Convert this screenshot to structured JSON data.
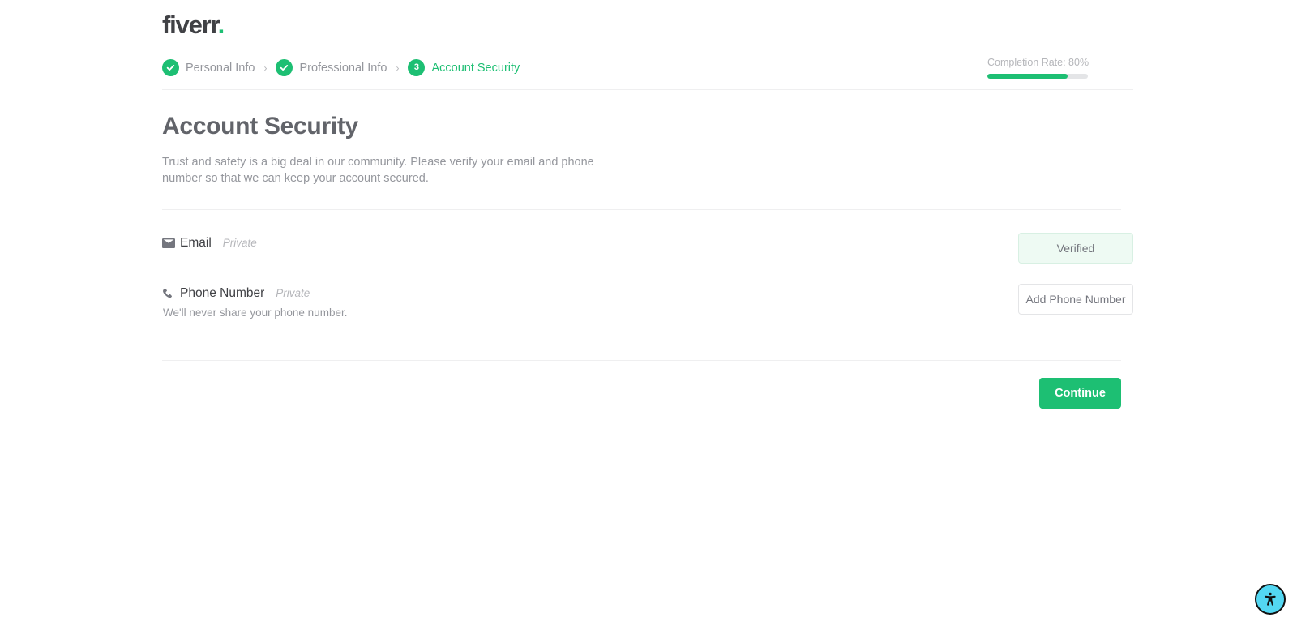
{
  "brand": {
    "name": "fiverr",
    "dot": ".",
    "accent_color": "#1dbf73"
  },
  "stepper": {
    "steps": [
      {
        "badge": "check",
        "label": "Personal Info",
        "state": "completed"
      },
      {
        "badge": "check",
        "label": "Professional Info",
        "state": "completed"
      },
      {
        "badge": "3",
        "label": "Account Security",
        "state": "current"
      }
    ],
    "separator": "›",
    "completion": {
      "label": "Completion Rate: 80%",
      "percent": 80
    }
  },
  "main": {
    "title": "Account Security",
    "description": "Trust and safety is a big deal in our community. Please verify your email and phone number so that we can keep your account secured.",
    "rows": [
      {
        "icon": "envelope-icon",
        "title": "Email",
        "privacy": "Private",
        "subtitle": "",
        "action_label": "Verified"
      },
      {
        "icon": "phone-icon",
        "title": "Phone Number",
        "privacy": "Private",
        "subtitle": "We'll never share your phone number.",
        "action_label": "Add Phone Number"
      }
    ],
    "continue_label": "Continue"
  },
  "accessibility_widget": {
    "icon": "accessibility-icon",
    "background_color": "#53d7f2"
  }
}
